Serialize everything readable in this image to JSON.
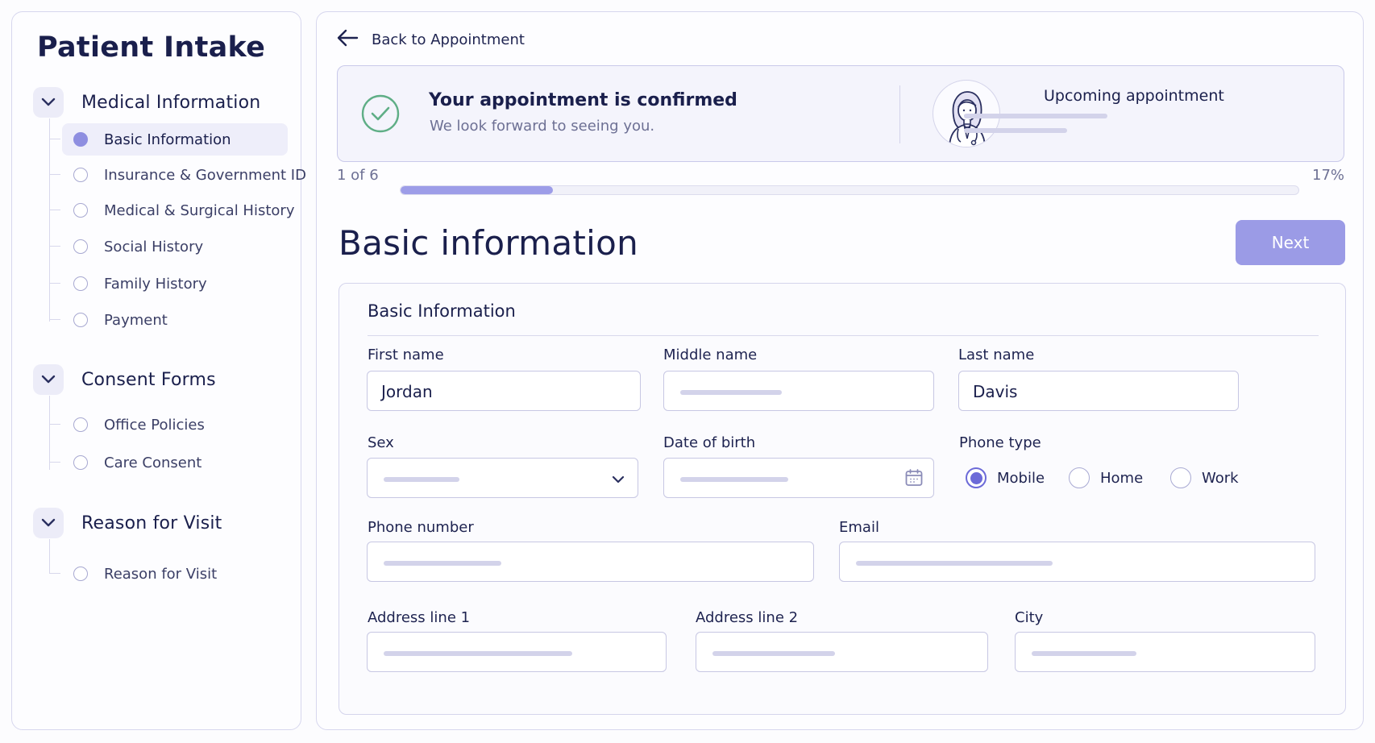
{
  "sidebar": {
    "title": "Patient Intake",
    "sections": [
      {
        "title": "Medical Information",
        "items": [
          {
            "label": "Basic Information",
            "active": true
          },
          {
            "label": "Insurance & Government ID",
            "active": false
          },
          {
            "label": "Medical & Surgical History",
            "active": false
          },
          {
            "label": "Social History",
            "active": false
          },
          {
            "label": "Family History",
            "active": false
          },
          {
            "label": "Payment",
            "active": false
          }
        ]
      },
      {
        "title": "Consent Forms",
        "items": [
          {
            "label": "Office Policies",
            "active": false
          },
          {
            "label": "Care Consent",
            "active": false
          }
        ]
      },
      {
        "title": "Reason for Visit",
        "items": [
          {
            "label": "Reason for Visit",
            "active": false
          }
        ]
      }
    ]
  },
  "header": {
    "back_label": "Back to Appointment",
    "confirmation_title": "Your appointment is confirmed",
    "confirmation_subtitle": "We look forward to seeing you.",
    "upcoming_title": "Upcoming appointment"
  },
  "progress": {
    "step_text": "1 of 6",
    "percent_text": "17%",
    "fraction": 0.17
  },
  "page": {
    "title": "Basic information",
    "next_label": "Next"
  },
  "form": {
    "section_title": "Basic Information",
    "first_name": {
      "label": "First name",
      "value": "Jordan"
    },
    "middle_name": {
      "label": "Middle name",
      "value": ""
    },
    "last_name": {
      "label": "Last name",
      "value": "Davis"
    },
    "sex": {
      "label": "Sex",
      "value": ""
    },
    "dob": {
      "label": "Date of birth",
      "value": ""
    },
    "phone_type": {
      "label": "Phone type",
      "options": [
        "Mobile",
        "Home",
        "Work"
      ],
      "selected": "Mobile"
    },
    "phone_number": {
      "label": "Phone number",
      "value": ""
    },
    "email": {
      "label": "Email",
      "value": ""
    },
    "address1": {
      "label": "Address line 1",
      "value": ""
    },
    "address2": {
      "label": "Address line 2",
      "value": ""
    },
    "city": {
      "label": "City",
      "value": ""
    }
  },
  "icons": {
    "back": "arrow-left-icon",
    "confirm": "check-circle-icon",
    "avatar": "doctor-avatar-icon",
    "section_toggle": "chevron-down-icon",
    "sex_dropdown": "chevron-down-icon",
    "dob_picker": "calendar-icon"
  },
  "colors": {
    "accent": "#9b9be6",
    "accent_dark": "#6c6ad8",
    "success": "#5fae86",
    "text": "#1a1f4c"
  }
}
